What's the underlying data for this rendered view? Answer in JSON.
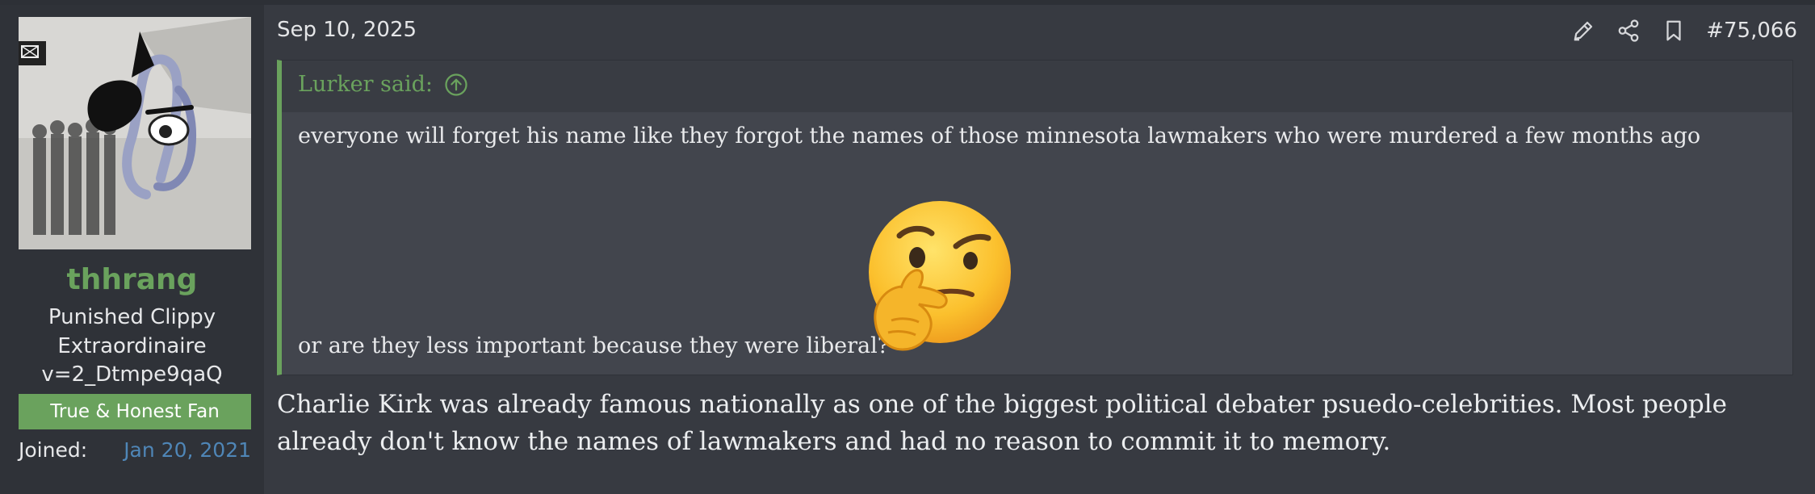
{
  "user": {
    "name": "thhrang",
    "title_line1": "Punished Clippy",
    "title_line2": "Extraordinaire",
    "title_line3": "v=2_Dtmpe9qaQ",
    "banner": "True & Honest Fan",
    "joined_label": "Joined:",
    "joined_date": "Jan 20, 2021"
  },
  "post": {
    "date": "Sep 10, 2025",
    "number": "#75,066",
    "action_icons": [
      "edit-icon",
      "share-icon",
      "bookmark-icon"
    ],
    "quote": {
      "attribution": "Lurker said:",
      "line1": "everyone will forget his name like they forgot the names of those minnesota lawmakers who were murdered a few months ago",
      "line2": "or are they less important because they were liberal?",
      "emoji": "thinking-face-emoji"
    },
    "body": "Charlie Kirk was already famous nationally as one of the biggest political debater psuedo-celebrities. Most people already don't know the names of lawmakers and had no reason to commit it to memory."
  },
  "colors": {
    "accent_green": "#6aa25d",
    "link_blue": "#4f86b7",
    "background": "#373a41",
    "sidebar": "#2f3238",
    "quote_bg": "#42454d"
  }
}
